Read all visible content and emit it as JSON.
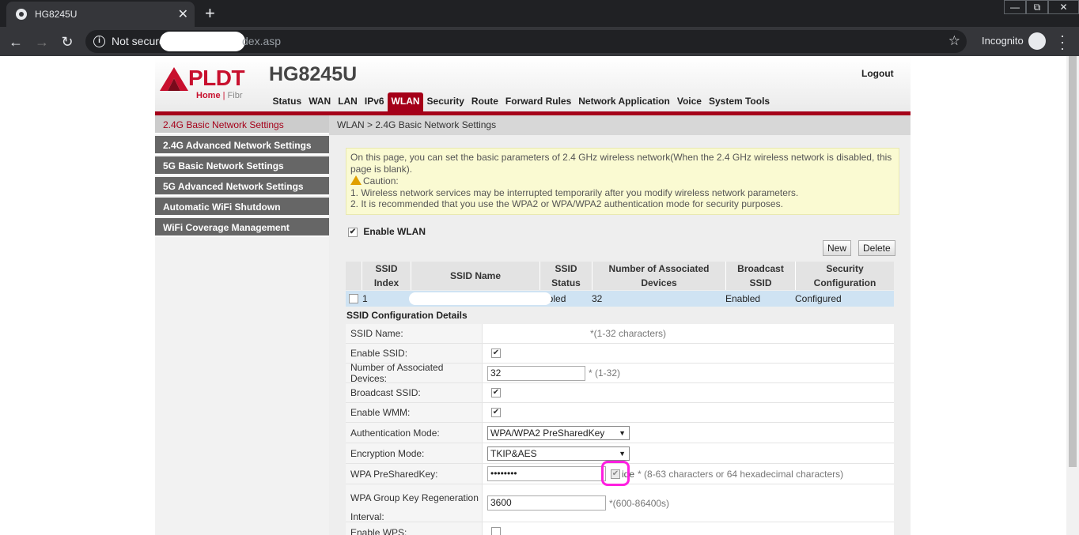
{
  "browser": {
    "tab_title": "HG8245U",
    "tab_close": "✕",
    "new_tab": "+",
    "security_label": "Not secure",
    "url_tail": "dex.asp",
    "incognito_label": "Incognito",
    "win_min": "—",
    "win_restore": "⧉",
    "win_close": "✕"
  },
  "header": {
    "brand": "PLDT",
    "brand_sub_home": "Home",
    "brand_sub_fibr": "Fibr",
    "model": "HG8245U",
    "logout": "Logout"
  },
  "main_nav": {
    "items": [
      "Status",
      "WAN",
      "LAN",
      "IPv6",
      "WLAN",
      "Security",
      "Route",
      "Forward Rules",
      "Network Application",
      "Voice",
      "System Tools"
    ],
    "active": "WLAN"
  },
  "sidebar": {
    "items": [
      "2.4G Basic Network Settings",
      "2.4G Advanced Network Settings",
      "5G Basic Network Settings",
      "5G Advanced Network Settings",
      "Automatic WiFi Shutdown",
      "WiFi Coverage Management"
    ],
    "active": "2.4G Basic Network Settings"
  },
  "breadcrumb": "WLAN > 2.4G Basic Network Settings",
  "notice": {
    "line1": "On this page, you can set the basic parameters of 2.4 GHz wireless network(When the 2.4 GHz wireless network is disabled, this page is blank).",
    "caution": "Caution:",
    "item1": "1. Wireless network services may be interrupted temporarily after you modify wireless network parameters.",
    "item2": "2. It is recommended that you use the WPA2 or WPA/WPA2 authentication mode for security purposes."
  },
  "enable_wlan": {
    "label": "Enable WLAN",
    "checked": true
  },
  "buttons": {
    "new": "New",
    "delete": "Delete"
  },
  "ssid_table": {
    "headers": [
      "SSID Index",
      "SSID Name",
      "SSID Status",
      "Number of Associated Devices",
      "Broadcast SSID",
      "Security Configuration"
    ],
    "rows": [
      {
        "index": "1",
        "name": "",
        "status": "abled",
        "devices": "32",
        "broadcast": "Enabled",
        "security": "Configured"
      }
    ]
  },
  "details": {
    "title": "SSID Configuration Details",
    "ssid_name": {
      "label": "SSID Name:",
      "hint": "*(1-32 characters)"
    },
    "enable_ssid": {
      "label": "Enable SSID:",
      "checked": true
    },
    "assoc_devices": {
      "label": "Number of Associated Devices:",
      "value": "32",
      "hint": "* (1-32)"
    },
    "broadcast_ssid": {
      "label": "Broadcast SSID:",
      "checked": true
    },
    "enable_wmm": {
      "label": "Enable WMM:",
      "checked": true
    },
    "auth_mode": {
      "label": "Authentication Mode:",
      "value": "WPA/WPA2 PreSharedKey"
    },
    "encryption_mode": {
      "label": "Encryption Mode:",
      "value": "TKIP&AES"
    },
    "psk": {
      "label": "WPA PreSharedKey:",
      "value": "••••••••",
      "hide_label": "ide",
      "hint": "* (8-63 characters or 64 hexadecimal characters)"
    },
    "group_key": {
      "label_line1": "WPA Group Key Regeneration",
      "label_line2": "Interval:",
      "value": "3600",
      "hint": "*(600-86400s)"
    },
    "enable_wps": {
      "label": "Enable WPS:"
    }
  },
  "colors": {
    "brand_red": "#a50019",
    "logo_red": "#c8102e",
    "selected_row": "#cfe3f3",
    "notice_bg": "#fafad2",
    "annotation_pink": "#ff1fe0"
  },
  "icons": [
    "globe-icon",
    "back-icon",
    "forward-icon",
    "reload-icon",
    "info-icon",
    "star-icon",
    "incognito-icon",
    "kebab-menu-icon",
    "warning-icon",
    "checkmark-icon",
    "dropdown-arrow-icon"
  ]
}
